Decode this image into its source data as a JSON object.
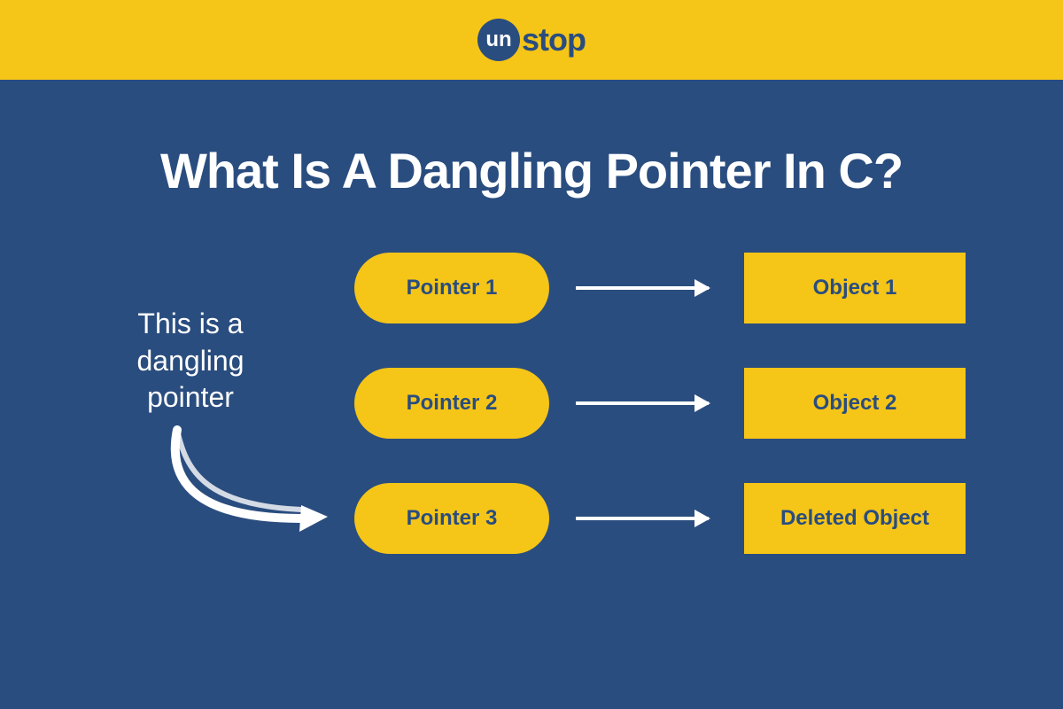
{
  "logo": {
    "circle_text": "un",
    "rest_text": "stop"
  },
  "title": "What Is A Dangling Pointer In C?",
  "annotation": "This is a\ndangling\npointer",
  "rows": [
    {
      "pointer": "Pointer 1",
      "object": "Object 1"
    },
    {
      "pointer": "Pointer 2",
      "object": "Object 2"
    },
    {
      "pointer": "Pointer 3",
      "object": "Deleted Object"
    }
  ],
  "colors": {
    "yellow": "#f5c518",
    "navy": "#2a4d7f",
    "white": "#ffffff"
  }
}
